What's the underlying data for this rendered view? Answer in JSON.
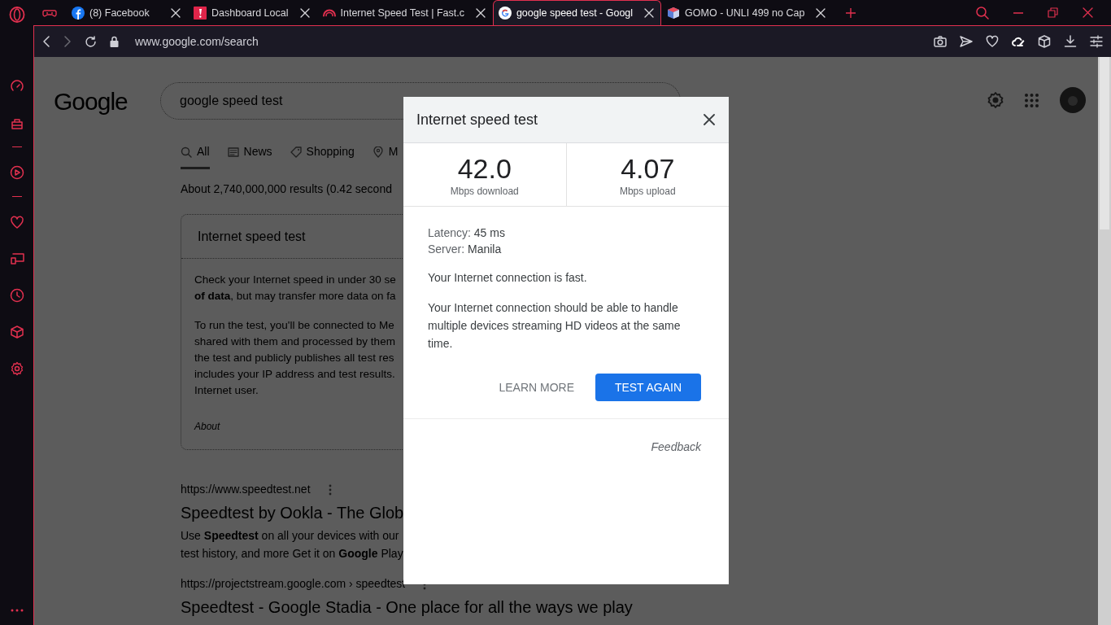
{
  "browser": {
    "tabs": [
      {
        "kind": "game",
        "selected": false
      },
      {
        "kind": "facebook",
        "title": "(8) Facebook",
        "selected": false
      },
      {
        "kind": "dashboard",
        "title": "Dashboard Local",
        "selected": false
      },
      {
        "kind": "fast",
        "title": "Internet Speed Test | Fast.c",
        "selected": false
      },
      {
        "kind": "google",
        "title": "google speed test - Googl",
        "selected": true
      },
      {
        "kind": "gomo",
        "title": "GOMO - UNLI 499 no Cap",
        "selected": false
      }
    ],
    "address": "www.google.com/search"
  },
  "search": {
    "logo": "Google",
    "query": "google speed test",
    "nav": [
      {
        "kind": "all",
        "label": "All",
        "selected": true
      },
      {
        "kind": "news",
        "label": "News",
        "selected": false
      },
      {
        "kind": "shopping",
        "label": "Shopping",
        "selected": false
      },
      {
        "kind": "maps",
        "label": "M",
        "selected": false
      }
    ],
    "result_stats": "About 2,740,000,000 results (0.42 second",
    "card": {
      "title": "Internet speed test",
      "paragraphs": [
        [
          "Check your Internet speed in under 30 se",
          "**of data**, but may transfer more data on fa"
        ],
        [
          "To run the test, you'll be connected to Me",
          "shared with them and processed by them",
          "the test and publicly publishes all test res",
          "includes your IP address and test results.",
          "Internet user."
        ]
      ],
      "about": "About"
    },
    "results": [
      {
        "url": "https://www.speedtest.net",
        "title": "Speedtest by Ookla - The Glob",
        "snippet": [
          "Use **Speedtest** on all your devices with our",
          "test history, and more Get it on **Google** Play"
        ]
      },
      {
        "url": "https://projectstream.google.com › speedtest",
        "title": "Speedtest - Google Stadia - One place for all the ways we play"
      }
    ]
  },
  "dialog": {
    "title": "Internet speed test",
    "stats": [
      {
        "value": "42.0",
        "unit": "Mbps download"
      },
      {
        "value": "4.07",
        "unit": "Mbps upload"
      }
    ],
    "details": [
      {
        "label": "Latency:",
        "value": "45 ms"
      },
      {
        "label": "Server:",
        "value": "Manila"
      }
    ],
    "message": "Your Internet connection is fast.",
    "explanation": "Your Internet connection should be able to handle multiple devices streaming HD videos at the same time.",
    "learn_more": "LEARN MORE",
    "test_again": "TEST AGAIN",
    "feedback": "Feedback"
  }
}
